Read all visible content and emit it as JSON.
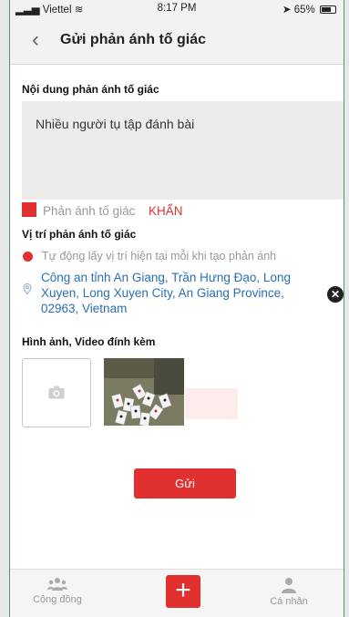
{
  "status_bar": {
    "carrier": "Viettel",
    "time": "8:17 PM",
    "battery": "65%"
  },
  "header": {
    "back_icon": "chevron-left-icon",
    "title": "Gửi phản ánh tố giác"
  },
  "form": {
    "content_label": "Nội dung phản ánh tố giác",
    "content_value": "Nhiều người tụ tập đánh bài",
    "urgent_label": "Phản ánh tố giác",
    "urgent_flag": "KHẨN",
    "location_label": "Vị trí phản ánh tố giác",
    "auto_location_text": "Tự động lấy vị trí hiện tại mỗi khi tạo phản ánh",
    "address": "Công an tỉnh An Giang, Trần Hưng Đạo, Long Xuyen, Long Xuyen City, An Giang Province, 02963, Vietnam",
    "attachments_label": "Hình ảnh, Video đính kèm",
    "submit_label": "Gửi"
  },
  "tab_bar": {
    "community_label": "Cộng đồng",
    "add_label": "+",
    "profile_label": "Cá nhân"
  },
  "colors": {
    "accent": "#e03030",
    "link": "#2a6fb5"
  }
}
